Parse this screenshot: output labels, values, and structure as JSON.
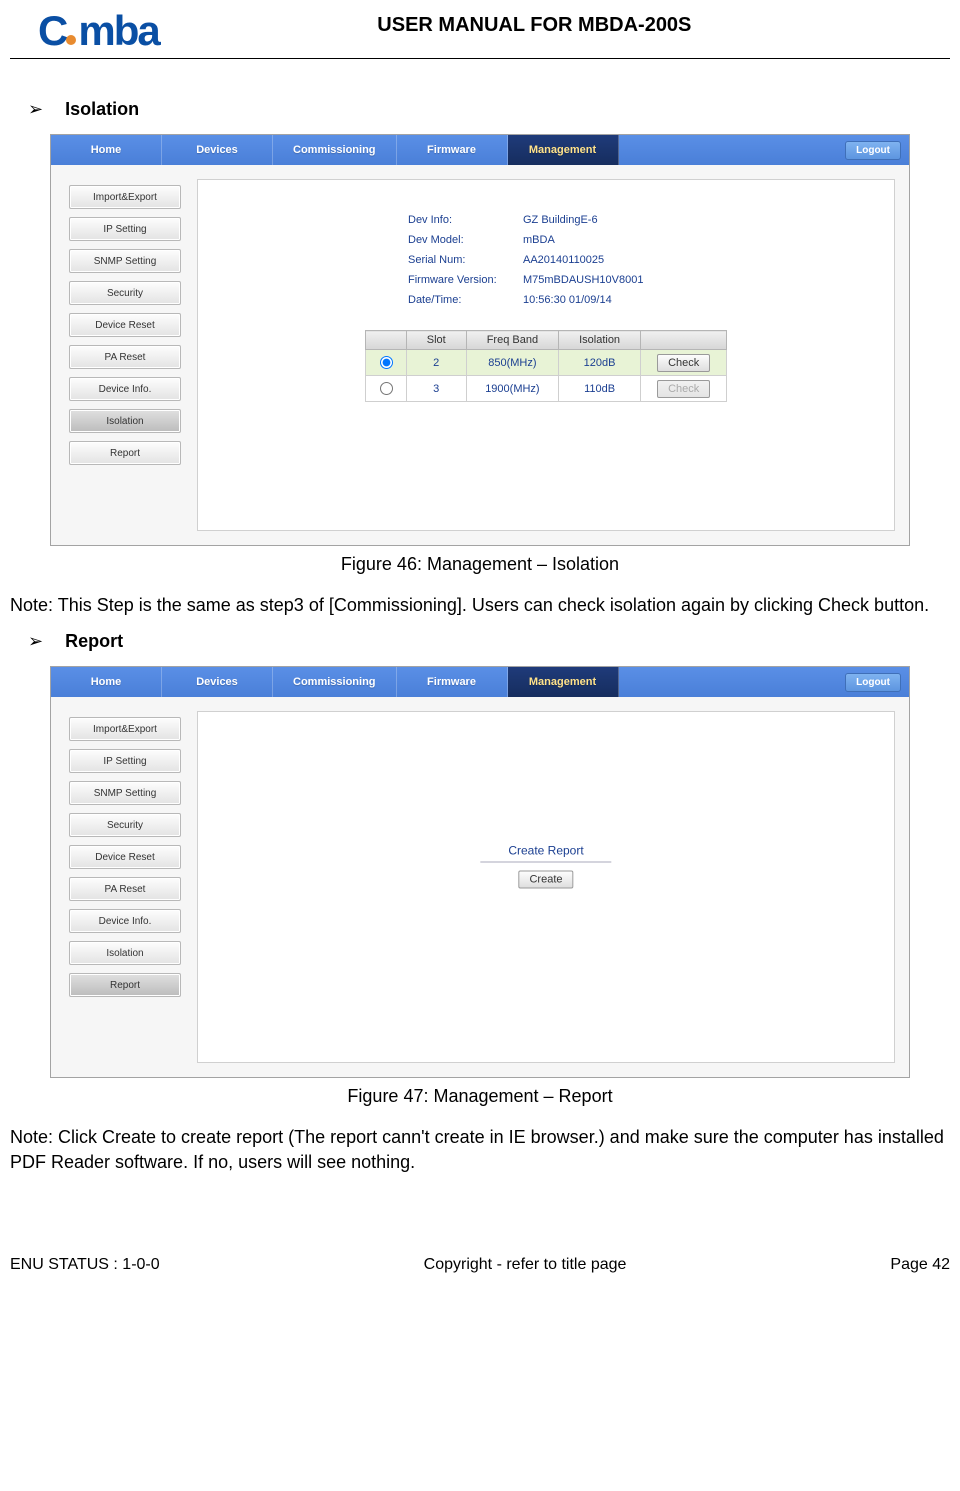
{
  "header": {
    "logo_text": "Comba",
    "title": "USER MANUAL FOR MBDA-200S"
  },
  "section1": {
    "heading": "Isolation",
    "caption": "Figure 46: Management – Isolation",
    "note": "Note: This Step is the same as step3 of [Commissioning]. Users can check isolation again by clicking Check button."
  },
  "section2": {
    "heading": "Report",
    "caption": "Figure 47: Management – Report",
    "note": "Note: Click Create to create report (The report cann't create in IE browser.) and make sure the computer has installed PDF Reader software. If no, users will see nothing."
  },
  "ui": {
    "nav": [
      "Home",
      "Devices",
      "Commissioning",
      "Firmware",
      "Management"
    ],
    "logout": "Logout",
    "sidebar": [
      "Import&Export",
      "IP Setting",
      "SNMP Setting",
      "Security",
      "Device Reset",
      "PA Reset",
      "Device Info.",
      "Isolation",
      "Report"
    ],
    "dev": {
      "labels": [
        "Dev Info:",
        "Dev Model:",
        "Serial Num:",
        "Firmware Version:",
        "Date/Time:"
      ],
      "values": [
        "GZ BuildingE-6",
        "mBDA",
        "AA20140110025",
        "M75mBDAUSH10V8001",
        "10:56:30 01/09/14"
      ]
    },
    "table": {
      "headers": [
        "",
        "Slot",
        "Freq Band",
        "Isolation",
        ""
      ],
      "rows": [
        {
          "selected": true,
          "slot": "2",
          "band": "850(MHz)",
          "iso": "120dB",
          "btn": "Check",
          "enabled": true
        },
        {
          "selected": false,
          "slot": "3",
          "band": "1900(MHz)",
          "iso": "110dB",
          "btn": "Check",
          "enabled": false
        }
      ]
    },
    "report": {
      "title": "Create Report",
      "button": "Create"
    }
  },
  "footer": {
    "left": "ENU STATUS : 1-0-0",
    "center": "Copyright - refer to title page",
    "right": "Page 42"
  }
}
